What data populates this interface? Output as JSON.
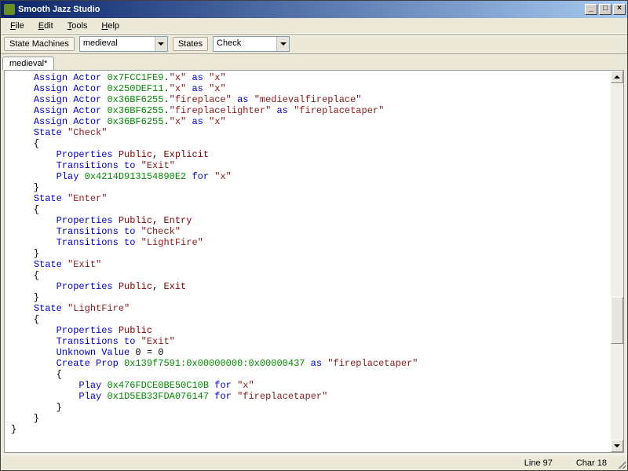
{
  "window": {
    "title": "Smooth Jazz Studio"
  },
  "menu": {
    "file": "File",
    "edit": "Edit",
    "tools": "Tools",
    "help": "Help"
  },
  "toolbar": {
    "sm_label": "State Machines",
    "sm_value": "medieval",
    "states_label": "States",
    "states_value": "Check"
  },
  "tabs": {
    "t0": "medieval*"
  },
  "status": {
    "line": "Line 97",
    "char": "Char 18"
  },
  "code": {
    "lines": [
      {
        "indent": 1,
        "parts": [
          {
            "c": "kw",
            "t": "Assign Actor"
          },
          {
            "t": " "
          },
          {
            "c": "hex",
            "t": "0x7FCC1FE9"
          },
          {
            "t": "."
          },
          {
            "c": "str",
            "t": "\"x\""
          },
          {
            "t": " "
          },
          {
            "c": "kw",
            "t": "as"
          },
          {
            "t": " "
          },
          {
            "c": "str",
            "t": "\"x\""
          }
        ]
      },
      {
        "indent": 1,
        "parts": [
          {
            "c": "kw",
            "t": "Assign Actor"
          },
          {
            "t": " "
          },
          {
            "c": "hex",
            "t": "0x250DEF11"
          },
          {
            "t": "."
          },
          {
            "c": "str",
            "t": "\"x\""
          },
          {
            "t": " "
          },
          {
            "c": "kw",
            "t": "as"
          },
          {
            "t": " "
          },
          {
            "c": "str",
            "t": "\"x\""
          }
        ]
      },
      {
        "indent": 1,
        "parts": [
          {
            "c": "kw",
            "t": "Assign Actor"
          },
          {
            "t": " "
          },
          {
            "c": "hex",
            "t": "0x36BF6255"
          },
          {
            "t": "."
          },
          {
            "c": "str",
            "t": "\"fireplace\""
          },
          {
            "t": " "
          },
          {
            "c": "kw",
            "t": "as"
          },
          {
            "t": " "
          },
          {
            "c": "str",
            "t": "\"medievalfireplace\""
          }
        ]
      },
      {
        "indent": 1,
        "parts": [
          {
            "c": "kw",
            "t": "Assign Actor"
          },
          {
            "t": " "
          },
          {
            "c": "hex",
            "t": "0x36BF6255"
          },
          {
            "t": "."
          },
          {
            "c": "str",
            "t": "\"fireplacelighter\""
          },
          {
            "t": " "
          },
          {
            "c": "kw",
            "t": "as"
          },
          {
            "t": " "
          },
          {
            "c": "str",
            "t": "\"fireplacetaper\""
          }
        ]
      },
      {
        "indent": 1,
        "parts": [
          {
            "c": "kw",
            "t": "Assign Actor"
          },
          {
            "t": " "
          },
          {
            "c": "hex",
            "t": "0x36BF6255"
          },
          {
            "t": "."
          },
          {
            "c": "str",
            "t": "\"x\""
          },
          {
            "t": " "
          },
          {
            "c": "kw",
            "t": "as"
          },
          {
            "t": " "
          },
          {
            "c": "str",
            "t": "\"x\""
          }
        ]
      },
      {
        "indent": 1,
        "parts": [
          {
            "c": "kw",
            "t": "State"
          },
          {
            "t": " "
          },
          {
            "c": "str",
            "t": "\"Check\""
          }
        ]
      },
      {
        "indent": 1,
        "parts": [
          {
            "t": "{"
          }
        ]
      },
      {
        "indent": 2,
        "parts": [
          {
            "c": "kw",
            "t": "Properties"
          },
          {
            "t": " "
          },
          {
            "c": "kw2",
            "t": "Public"
          },
          {
            "t": ", "
          },
          {
            "c": "kw2",
            "t": "Explicit"
          }
        ]
      },
      {
        "indent": 2,
        "parts": [
          {
            "c": "kw",
            "t": "Transitions to"
          },
          {
            "t": " "
          },
          {
            "c": "str",
            "t": "\"Exit\""
          }
        ]
      },
      {
        "indent": 2,
        "parts": [
          {
            "c": "kw",
            "t": "Play"
          },
          {
            "t": " "
          },
          {
            "c": "hex",
            "t": "0x4214D913154890E2"
          },
          {
            "t": " "
          },
          {
            "c": "kw",
            "t": "for"
          },
          {
            "t": " "
          },
          {
            "c": "str",
            "t": "\"x\""
          }
        ]
      },
      {
        "indent": 1,
        "parts": [
          {
            "t": "}"
          }
        ]
      },
      {
        "indent": 1,
        "parts": [
          {
            "c": "kw",
            "t": "State"
          },
          {
            "t": " "
          },
          {
            "c": "str",
            "t": "\"Enter\""
          }
        ]
      },
      {
        "indent": 1,
        "parts": [
          {
            "t": "{"
          }
        ]
      },
      {
        "indent": 2,
        "parts": [
          {
            "c": "kw",
            "t": "Properties"
          },
          {
            "t": " "
          },
          {
            "c": "kw2",
            "t": "Public"
          },
          {
            "t": ", "
          },
          {
            "c": "kw2",
            "t": "Entry"
          }
        ]
      },
      {
        "indent": 2,
        "parts": [
          {
            "c": "kw",
            "t": "Transitions to"
          },
          {
            "t": " "
          },
          {
            "c": "str",
            "t": "\"Check\""
          }
        ]
      },
      {
        "indent": 2,
        "parts": [
          {
            "c": "kw",
            "t": "Transitions to"
          },
          {
            "t": " "
          },
          {
            "c": "str",
            "t": "\"LightFire\""
          }
        ]
      },
      {
        "indent": 1,
        "parts": [
          {
            "t": "}"
          }
        ]
      },
      {
        "indent": 1,
        "parts": [
          {
            "c": "kw",
            "t": "State"
          },
          {
            "t": " "
          },
          {
            "c": "str",
            "t": "\"Exit\""
          }
        ]
      },
      {
        "indent": 1,
        "parts": [
          {
            "t": "{"
          }
        ]
      },
      {
        "indent": 2,
        "parts": [
          {
            "c": "kw",
            "t": "Properties"
          },
          {
            "t": " "
          },
          {
            "c": "kw2",
            "t": "Public"
          },
          {
            "t": ", "
          },
          {
            "c": "kw2",
            "t": "Exit"
          }
        ]
      },
      {
        "indent": 1,
        "parts": [
          {
            "t": "}"
          }
        ]
      },
      {
        "indent": 1,
        "parts": [
          {
            "c": "kw",
            "t": "State"
          },
          {
            "t": " "
          },
          {
            "c": "str",
            "t": "\"LightFire\""
          }
        ]
      },
      {
        "indent": 1,
        "parts": [
          {
            "t": "{"
          }
        ]
      },
      {
        "indent": 2,
        "parts": [
          {
            "c": "kw",
            "t": "Properties"
          },
          {
            "t": " "
          },
          {
            "c": "kw2",
            "t": "Public"
          }
        ]
      },
      {
        "indent": 2,
        "parts": [
          {
            "c": "kw",
            "t": "Transitions to"
          },
          {
            "t": " "
          },
          {
            "c": "str",
            "t": "\"Exit\""
          }
        ]
      },
      {
        "indent": 2,
        "parts": [
          {
            "c": "kw",
            "t": "Unknown Value"
          },
          {
            "t": " 0 = 0"
          }
        ]
      },
      {
        "indent": 2,
        "parts": [
          {
            "c": "kw",
            "t": "Create Prop"
          },
          {
            "t": " "
          },
          {
            "c": "hex",
            "t": "0x139f7591:0x00000000:0x00000437"
          },
          {
            "t": " "
          },
          {
            "c": "kw",
            "t": "as"
          },
          {
            "t": " "
          },
          {
            "c": "str",
            "t": "\"fireplacetaper\""
          }
        ]
      },
      {
        "indent": 2,
        "parts": [
          {
            "t": "{"
          }
        ]
      },
      {
        "indent": 3,
        "parts": [
          {
            "c": "kw",
            "t": "Play"
          },
          {
            "t": " "
          },
          {
            "c": "hex",
            "t": "0x476FDCE0BE50C10B"
          },
          {
            "t": " "
          },
          {
            "c": "kw",
            "t": "for"
          },
          {
            "t": " "
          },
          {
            "c": "str",
            "t": "\"x\""
          }
        ]
      },
      {
        "indent": 3,
        "parts": [
          {
            "c": "kw",
            "t": "Play"
          },
          {
            "t": " "
          },
          {
            "c": "hex",
            "t": "0x1D5EB33FDA076147"
          },
          {
            "t": " "
          },
          {
            "c": "kw",
            "t": "for"
          },
          {
            "t": " "
          },
          {
            "c": "str",
            "t": "\"fireplacetaper\""
          }
        ]
      },
      {
        "indent": 2,
        "parts": [
          {
            "t": "}"
          }
        ]
      },
      {
        "indent": 1,
        "parts": [
          {
            "t": "}"
          }
        ]
      },
      {
        "indent": 0,
        "parts": [
          {
            "t": "}"
          }
        ]
      }
    ]
  }
}
